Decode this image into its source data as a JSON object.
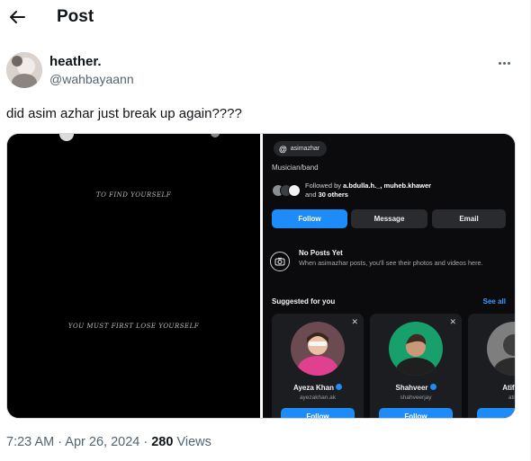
{
  "header": {
    "title": "Post"
  },
  "tweet": {
    "author_name": "heather.",
    "author_handle": "@wahbayaann",
    "text": "did asim azhar just break up again????",
    "timestamp": "7:23 AM · Apr 26, 2024 · ",
    "views_count": "280",
    "views_label": " Views"
  },
  "media": {
    "left_quote_top": "TO FIND YOURSELF",
    "left_quote_bottom": "YOU MUST FIRST LOSE YOURSELF",
    "profile": {
      "threads_username": "asimazhar",
      "category": "Musician/band",
      "followed_by_prefix": "Followed by ",
      "followed_by_names": "a.bdulla.h._, muheb.khawer",
      "followed_by_and": "and ",
      "followed_by_others": "30 others",
      "follow_label": "Follow",
      "message_label": "Message",
      "email_label": "Email",
      "no_posts_title": "No Posts Yet",
      "no_posts_sub": "When asimazhar posts, you'll see their photos and videos here.",
      "suggested_title": "Suggested for you",
      "see_all_label": "See all",
      "suggestions": [
        {
          "name": "Ayeza Khan",
          "handle": "ayezakhan.ak",
          "follow": "Follow"
        },
        {
          "name": "Shahveer",
          "handle": "shahveerjay",
          "follow": "Follow"
        },
        {
          "name": "Atif As",
          "handle": "atifa",
          "follow": "F"
        }
      ]
    }
  },
  "colors": {
    "accent_blue": "#1d8cf8",
    "text_primary": "#0f1419",
    "text_secondary": "#536471"
  }
}
